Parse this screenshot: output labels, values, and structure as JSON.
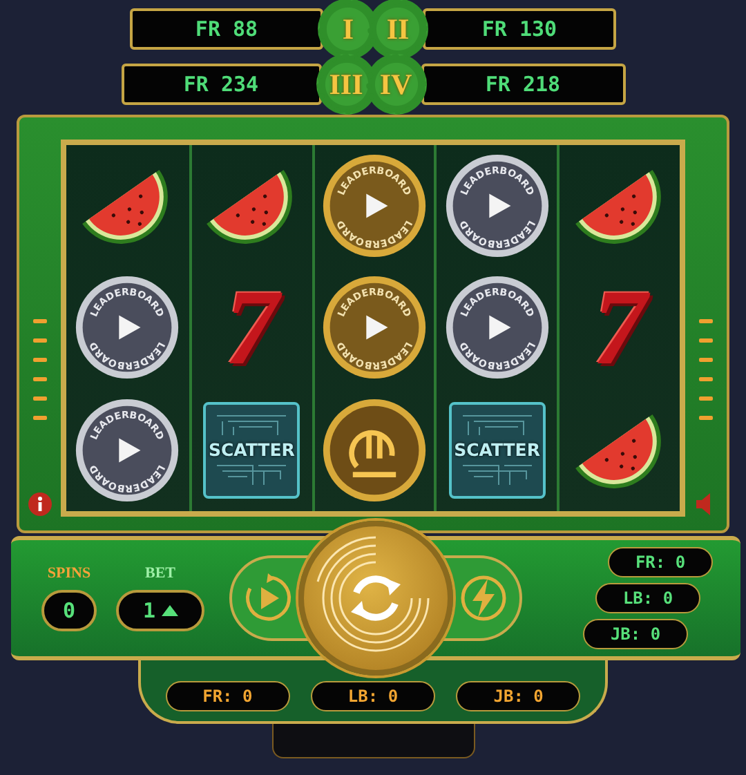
{
  "jackpots": [
    {
      "numeral": "I",
      "value": "FR 88"
    },
    {
      "numeral": "II",
      "value": "FR 130"
    },
    {
      "numeral": "III",
      "value": "FR 234"
    },
    {
      "numeral": "IV",
      "value": "FR 218"
    }
  ],
  "reels": [
    [
      {
        "kind": "watermelon"
      },
      {
        "kind": "silver-coin",
        "top": "LEADERBOARD",
        "bottom": "LEADERBOARD"
      },
      {
        "kind": "silver-coin",
        "top": "LEADERBOARD",
        "bottom": "LEADERBOARD"
      }
    ],
    [
      {
        "kind": "watermelon"
      },
      {
        "kind": "seven",
        "text": "7"
      },
      {
        "kind": "scatter",
        "text": "SCATTER"
      }
    ],
    [
      {
        "kind": "gold-coin",
        "top": "LEADERBOARD",
        "bottom": "LEADERBOARD"
      },
      {
        "kind": "gold-coin",
        "top": "LEADERBOARD",
        "bottom": "LEADERBOARD"
      },
      {
        "kind": "currency-coin"
      }
    ],
    [
      {
        "kind": "silver-coin",
        "top": "LEADERBOARD",
        "bottom": "LEADERBOARD"
      },
      {
        "kind": "silver-coin",
        "top": "LEADERBOARD",
        "bottom": "LEADERBOARD"
      },
      {
        "kind": "scatter",
        "text": "SCATTER"
      }
    ],
    [
      {
        "kind": "watermelon"
      },
      {
        "kind": "seven",
        "text": "7"
      },
      {
        "kind": "watermelon"
      }
    ]
  ],
  "spins": {
    "label": "SPINS",
    "value": "0"
  },
  "bet": {
    "label": "BET",
    "value": "1"
  },
  "side_counters": [
    "FR: 0",
    "LB: 0",
    "JB: 0"
  ],
  "bottom_counters": [
    "FR: 0",
    "LB: 0",
    "JB: 0"
  ]
}
